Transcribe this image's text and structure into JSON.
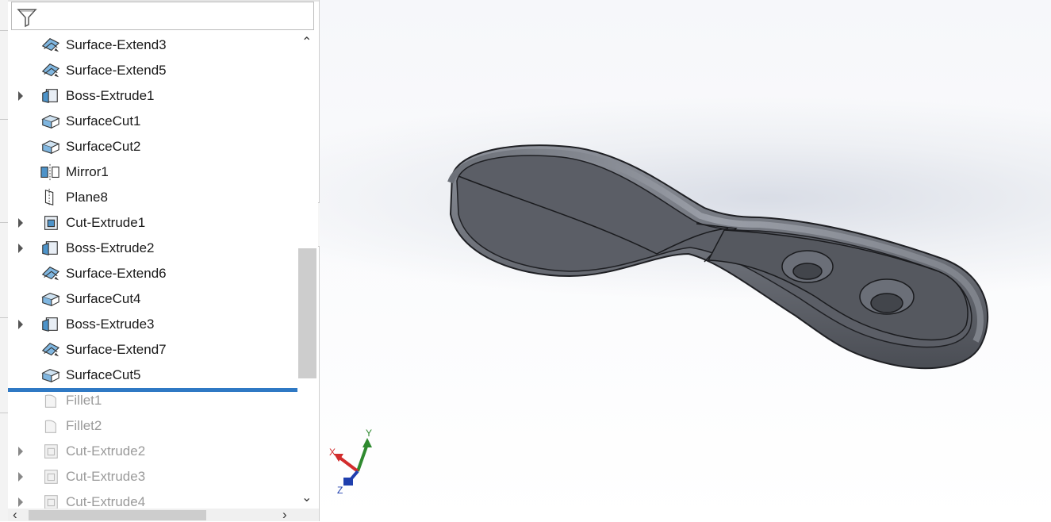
{
  "tree": {
    "items": [
      {
        "label": "Surface-Extend3",
        "icon": "surface-extend-icon",
        "expandable": false,
        "suppressed": false
      },
      {
        "label": "Surface-Extend5",
        "icon": "surface-extend-icon",
        "expandable": false,
        "suppressed": false
      },
      {
        "label": "Boss-Extrude1",
        "icon": "boss-extrude-icon",
        "expandable": true,
        "suppressed": false
      },
      {
        "label": "SurfaceCut1",
        "icon": "surface-cut-icon",
        "expandable": false,
        "suppressed": false
      },
      {
        "label": "SurfaceCut2",
        "icon": "surface-cut-icon",
        "expandable": false,
        "suppressed": false
      },
      {
        "label": "Mirror1",
        "icon": "mirror-icon",
        "expandable": false,
        "suppressed": false
      },
      {
        "label": "Plane8",
        "icon": "plane-icon",
        "expandable": false,
        "suppressed": false
      },
      {
        "label": "Cut-Extrude1",
        "icon": "cut-extrude-icon",
        "expandable": true,
        "suppressed": false
      },
      {
        "label": "Boss-Extrude2",
        "icon": "boss-extrude-icon",
        "expandable": true,
        "suppressed": false
      },
      {
        "label": "Surface-Extend6",
        "icon": "surface-extend-icon",
        "expandable": false,
        "suppressed": false
      },
      {
        "label": "SurfaceCut4",
        "icon": "surface-cut-icon",
        "expandable": false,
        "suppressed": false
      },
      {
        "label": "Boss-Extrude3",
        "icon": "boss-extrude-icon",
        "expandable": true,
        "suppressed": false
      },
      {
        "label": "Surface-Extend7",
        "icon": "surface-extend-icon",
        "expandable": false,
        "suppressed": false
      },
      {
        "label": "SurfaceCut5",
        "icon": "surface-cut-icon",
        "expandable": false,
        "suppressed": false
      },
      {
        "label": "Fillet1",
        "icon": "fillet-icon",
        "expandable": false,
        "suppressed": true
      },
      {
        "label": "Fillet2",
        "icon": "fillet-icon",
        "expandable": false,
        "suppressed": true
      },
      {
        "label": "Cut-Extrude2",
        "icon": "cut-extrude-icon",
        "expandable": true,
        "suppressed": true
      },
      {
        "label": "Cut-Extrude3",
        "icon": "cut-extrude-icon",
        "expandable": true,
        "suppressed": true
      },
      {
        "label": "Cut-Extrude4",
        "icon": "cut-extrude-icon",
        "expandable": true,
        "suppressed": true
      }
    ]
  },
  "triad": {
    "x": "X",
    "y": "Y",
    "z": "Z"
  },
  "colors": {
    "accent": "#2f79c4",
    "model": "#5b5e66",
    "x_axis": "#d22c2c",
    "y_axis": "#2f8a2f",
    "z_axis": "#1f3fae"
  }
}
